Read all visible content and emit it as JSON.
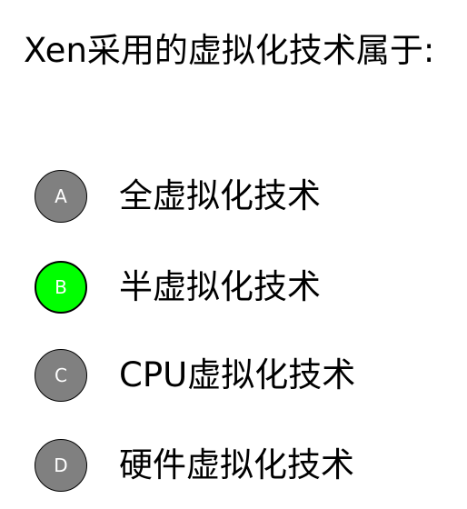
{
  "question": {
    "text": "Xen采用的虚拟化技术属于:"
  },
  "options": [
    {
      "letter": "A",
      "text": "全虚拟化技术",
      "selected": false
    },
    {
      "letter": "B",
      "text": "半虚拟化技术",
      "selected": true
    },
    {
      "letter": "C",
      "text": "CPU虚拟化技术",
      "selected": false
    },
    {
      "letter": "D",
      "text": "硬件虚拟化技术",
      "selected": false
    }
  ],
  "colors": {
    "badge_default": "#808080",
    "badge_selected": "#00ff00",
    "badge_border": "#000000",
    "text": "#000000",
    "background": "#ffffff"
  }
}
